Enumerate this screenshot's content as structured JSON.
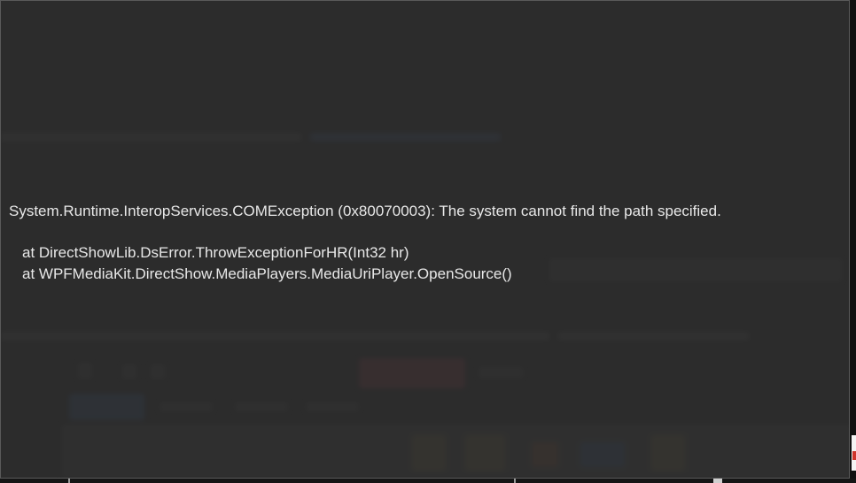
{
  "error_dialog": {
    "message": "System.Runtime.InteropServices.COMException (0x80070003): The system cannot find the path specified.",
    "stack_trace": [
      "at DirectShowLib.DsError.ThrowExceptionForHR(Int32 hr)",
      "at WPFMediaKit.DirectShow.MediaPlayers.MediaUriPlayer.OpenSource()"
    ]
  },
  "colors": {
    "overlay_background": "#303030",
    "text": "#e8e8e8",
    "border": "#5a5a5a"
  }
}
